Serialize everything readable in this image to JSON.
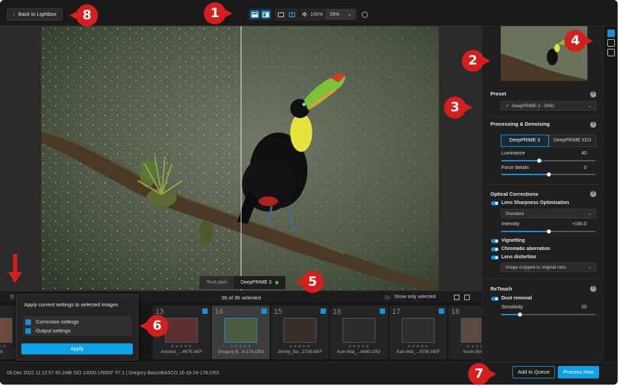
{
  "toolbar": {
    "back_label": "Back to Lightbox",
    "zoom_fit": "100%",
    "zoom_select": "25%"
  },
  "viewer": {
    "before_tag": "TextLabel",
    "after_tag": "DeepPRIME 3"
  },
  "filmstrip": {
    "count_label": "36 of 36 selected",
    "only_selected_label": "Show only selected",
    "thumbs": [
      {
        "num": "",
        "name": "..._149",
        "selected": false,
        "img": "#6b4a3a"
      },
      {
        "num": "",
        "name": "",
        "selected": false,
        "img": "#3a3a3a"
      },
      {
        "num": "13",
        "name": "Antoine_...4675.NEF",
        "selected": true,
        "img": "#5a3030"
      },
      {
        "num": "14",
        "name": "Gregory B...4-178.CR3",
        "selected": true,
        "img": "#4b5a3a"
      },
      {
        "num": "15",
        "name": "Jimmy_Be...2739.NEF",
        "selected": true,
        "img": "#3a2e28"
      },
      {
        "num": "16",
        "name": "Kah-Wai_...6860.CR2",
        "selected": true,
        "img": "#2c2c2c"
      },
      {
        "num": "17",
        "name": "Kah-Wai_...9780.NEF",
        "selected": true,
        "img": "#2e2e2e"
      },
      {
        "num": "18",
        "name": "Kevin BAR...3",
        "selected": false,
        "img": "#5a4a40"
      }
    ],
    "stars": "★★★★★"
  },
  "popover": {
    "title": "Apply current settings to selected images",
    "option1": "Correction settings",
    "option2": "Output settings",
    "apply_label": "Apply"
  },
  "statusbar": {
    "info": "08 Dec 2022 11:12:57   65.1MB   ISO 10000   1/5000\"   f/7.1   |   Gregory BascoBASCO 16-18-24-178.CR3",
    "queue_label": "Add to Queue",
    "process_label": "Process Now"
  },
  "panel": {
    "preset_title": "Preset",
    "preset_value": "DeepPRIME 3 - DNG",
    "processing_title": "Processing & Denoising",
    "seg_a": "DeepPRIME 3",
    "seg_b": "DeepPRIME XD3",
    "luminance_label": "Luminance",
    "luminance_value": "40",
    "luminance_fraction": 0.4,
    "force_label": "Force details",
    "force_value": "0",
    "force_fraction": 0.5,
    "optical_title": "Optical Corrections",
    "lens_sharpness_label": "Lens Sharpness Optimization",
    "sharpness_mode": "Standard",
    "intensity_label": "Intensity",
    "intensity_value": "+100.0",
    "intensity_fraction": 0.5,
    "vignetting_label": "Vignetting",
    "chromatic_label": "Chromatic aberration",
    "distortion_label": "Lens distortion",
    "distortion_mode": "Image cropped to original ratio",
    "retouch_title": "ReTouch",
    "dust_label": "Dust removal",
    "sensitivity_label": "Sensitivity",
    "sensitivity_value": "20",
    "sensitivity_fraction": 0.2,
    "help": "?"
  },
  "callouts": [
    "1",
    "2",
    "3",
    "4",
    "5",
    "6",
    "7",
    "8"
  ],
  "colors": {
    "accent": "#0fa1e8",
    "callout_red": "#d41f1f",
    "status_green": "#2ec44a"
  }
}
